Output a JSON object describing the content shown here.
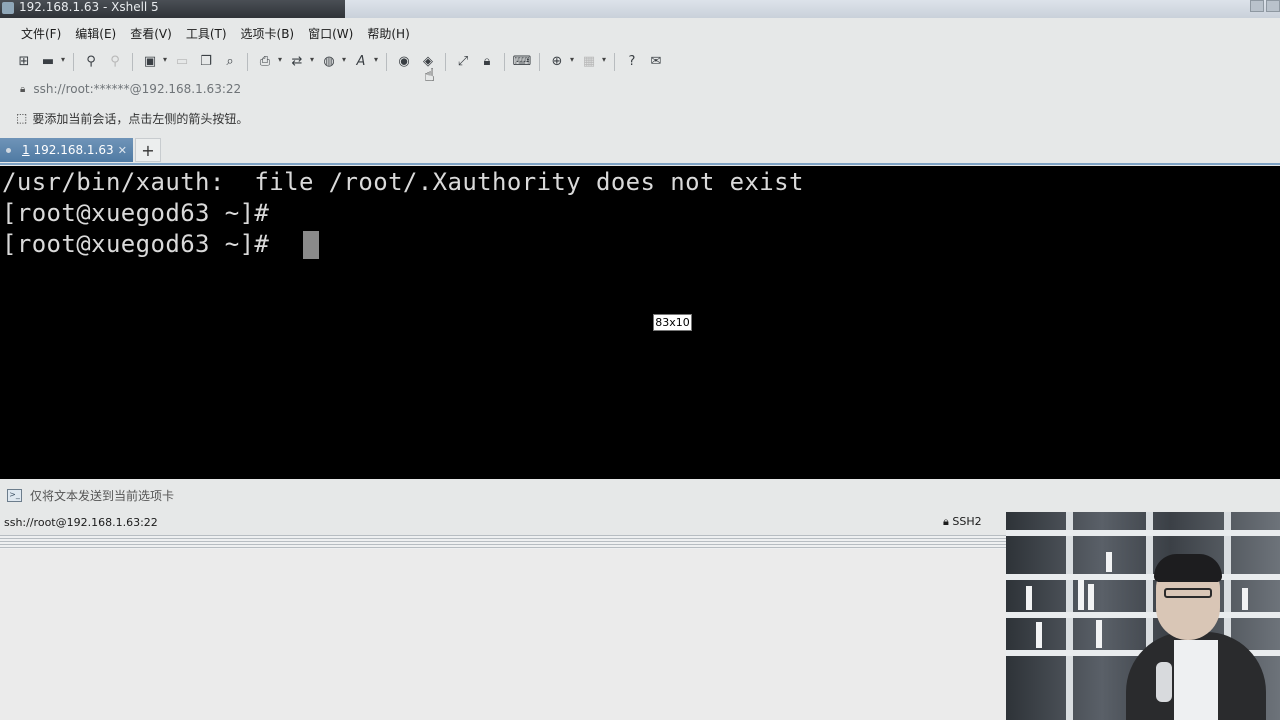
{
  "window": {
    "title": "192.168.1.63 - Xshell 5"
  },
  "menu": [
    {
      "label": "文件(F)"
    },
    {
      "label": "编辑(E)"
    },
    {
      "label": "查看(V)"
    },
    {
      "label": "工具(T)"
    },
    {
      "label": "选项卡(B)"
    },
    {
      "label": "窗口(W)"
    },
    {
      "label": "帮助(H)"
    }
  ],
  "toolbar": {
    "buttons": [
      {
        "icon": "new-session-icon"
      },
      {
        "icon": "open-folder-icon"
      },
      {
        "icon": "connect-icon"
      },
      {
        "icon": "disconnect-icon"
      },
      {
        "icon": "properties-icon"
      },
      {
        "icon": "copy-icon"
      },
      {
        "icon": "find-icon"
      },
      {
        "icon": "print-icon"
      },
      {
        "icon": "transfer-icon"
      },
      {
        "icon": "globe-icon"
      },
      {
        "icon": "font-icon"
      },
      {
        "icon": "xftp-icon"
      },
      {
        "icon": "xmanager-icon"
      },
      {
        "icon": "fullscreen-icon"
      },
      {
        "icon": "lock-icon"
      },
      {
        "icon": "keyboard-icon"
      },
      {
        "icon": "add-tab-icon"
      },
      {
        "icon": "layout-icon"
      },
      {
        "icon": "help-icon"
      },
      {
        "icon": "chat-icon"
      }
    ]
  },
  "address": {
    "value": "ssh://root:******@192.168.1.63:22"
  },
  "info": {
    "text": "要添加当前会话，点击左侧的箭头按钮。"
  },
  "tabs": [
    {
      "index": "1",
      "label": "192.168.1.63"
    }
  ],
  "terminal": {
    "lines": [
      "/usr/bin/xauth:  file /root/.Xauthority does not exist",
      "[root@xuegod63 ~]#",
      "[root@xuegod63 ~]# "
    ],
    "size_tooltip": "83x10"
  },
  "compose": {
    "text": "仅将文本发送到当前选项卡"
  },
  "status": {
    "session": "ssh://root@192.168.1.63:22",
    "protocol": "SSH2"
  }
}
